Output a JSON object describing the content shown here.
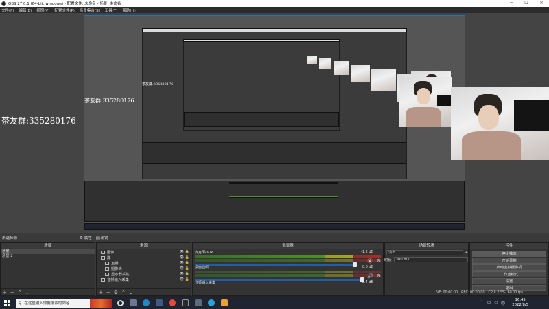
{
  "window": {
    "title": "OBS 27.0.1 (64-bit, windows) - 配置文件: 未命名 - 场景: 未命名"
  },
  "menu": [
    "文件(F)",
    "编辑(E)",
    "视图(V)",
    "配置文件(P)",
    "场景集合(S)",
    "工具(T)",
    "帮助(H)"
  ],
  "preview": {
    "group_text": "茶友群:335280176"
  },
  "scene_bar": {
    "current_scene": "未选择源",
    "properties_label": "属性",
    "filters_label": "滤镜"
  },
  "scenes": {
    "header": "场景",
    "items": [
      "场景",
      "场景 2"
    ]
  },
  "sources": {
    "header": "来源",
    "items": [
      {
        "name": "图像",
        "indent": 0
      },
      {
        "name": "群",
        "indent": 0
      },
      {
        "name": "直播",
        "indent": 1
      },
      {
        "name": "摄像头",
        "indent": 1
      },
      {
        "name": "显示器采集",
        "indent": 1
      },
      {
        "name": "音频输入采集",
        "indent": 0
      }
    ]
  },
  "mixer": {
    "header": "混音器",
    "channels": [
      {
        "name": "麦克风/Aux",
        "db": "-1.2 dB",
        "level": 0.82
      },
      {
        "name": "桌面音频",
        "db": "0.0 dB",
        "level": 0.9
      },
      {
        "name": "音频输入采集",
        "db": "-2.4 dB",
        "level": 0.6
      }
    ]
  },
  "transitions": {
    "header": "场景转场",
    "selected": "淡出",
    "duration_label": "时长",
    "duration_value": "300 ms"
  },
  "controls": {
    "header": "控件",
    "buttons": [
      "停止推流",
      "开始录制",
      "启动虚拟摄像机",
      "工作室模式",
      "设置",
      "退出"
    ]
  },
  "status": {
    "live": "LIVE: 00:00:00",
    "rec": "REC: 00:00:00",
    "cpu": "CPU: 2.5%, 60.00 fps"
  },
  "taskbar": {
    "search_placeholder": "在这里输入你要搜索的内容",
    "time": "16:45",
    "date": "2022/8/5"
  }
}
